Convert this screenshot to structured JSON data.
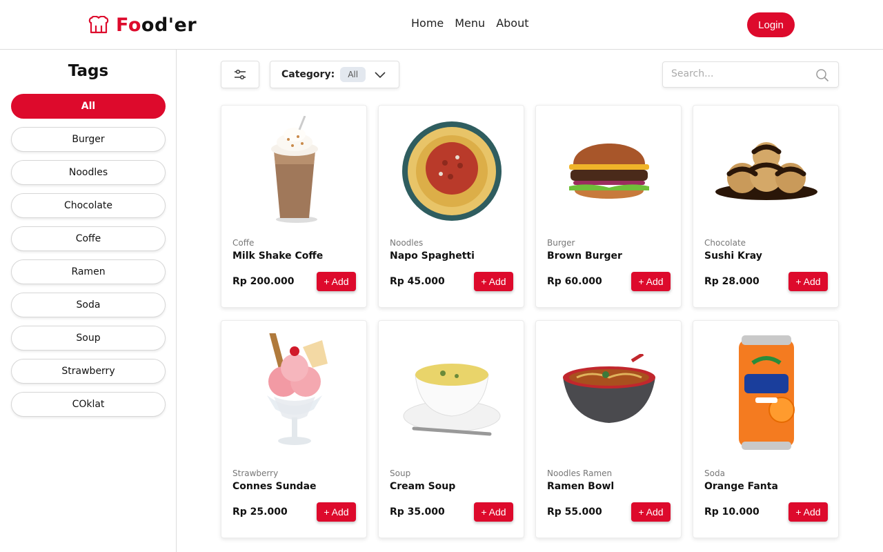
{
  "header": {
    "logo_prefix": "Fo",
    "logo_suffix": "od'er",
    "nav": [
      "Home",
      "Menu",
      "About"
    ],
    "login_label": "Login"
  },
  "sidebar": {
    "title": "Tags",
    "tags": [
      "All",
      "Burger",
      "Noodles",
      "Chocolate",
      "Coffe",
      "Ramen",
      "Soda",
      "Soup",
      "Strawberry",
      "COklat"
    ],
    "active_tag": "All"
  },
  "toolbar": {
    "category_label": "Category:",
    "category_value": "All",
    "search_placeholder": "Search..."
  },
  "products": [
    {
      "category": "Coffe",
      "name": "Milk Shake Coffe",
      "price": "Rp 200.000",
      "add_label": "+ Add",
      "image": "milkshake-image"
    },
    {
      "category": "Noodles",
      "name": "Napo Spaghetti",
      "price": "Rp 45.000",
      "add_label": "+ Add",
      "image": "spaghetti-image"
    },
    {
      "category": "Burger",
      "name": "Brown Burger",
      "price": "Rp 60.000",
      "add_label": "+ Add",
      "image": "burger-image"
    },
    {
      "category": "Chocolate",
      "name": "Sushi Kray",
      "price": "Rp 28.000",
      "add_label": "+ Add",
      "image": "chocolate-puffs-image"
    },
    {
      "category": "Strawberry",
      "name": "Connes Sundae",
      "price": "Rp 25.000",
      "add_label": "+ Add",
      "image": "sundae-image"
    },
    {
      "category": "Soup",
      "name": "Cream Soup",
      "price": "Rp 35.000",
      "add_label": "+ Add",
      "image": "soup-image"
    },
    {
      "category": "Noodles Ramen",
      "name": "Ramen Bowl",
      "price": "Rp 55.000",
      "add_label": "+ Add",
      "image": "ramen-image"
    },
    {
      "category": "Soda",
      "name": "Orange Fanta",
      "price": "Rp 10.000",
      "add_label": "+ Add",
      "image": "fanta-can-image"
    }
  ],
  "colors": {
    "accent": "#dd0a2c",
    "chip": "#e3e8ef"
  }
}
